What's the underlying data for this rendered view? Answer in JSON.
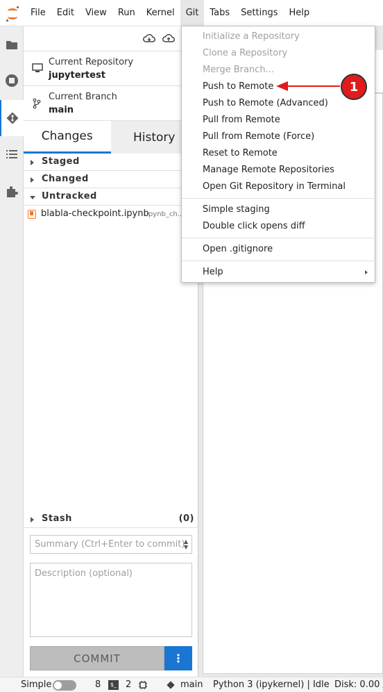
{
  "menubar": {
    "items": [
      "File",
      "Edit",
      "View",
      "Run",
      "Kernel",
      "Git",
      "Tabs",
      "Settings",
      "Help"
    ],
    "active": "Git"
  },
  "git_panel": {
    "repo_label": "Current Repository",
    "repo_value": "jupytertest",
    "branch_label": "Current Branch",
    "branch_value": "main",
    "tabs": {
      "changes": "Changes",
      "history": "History"
    },
    "sections": {
      "staged": "Staged",
      "changed": "Changed",
      "untracked": "Untracked",
      "stash": "Stash",
      "stash_count": "(0)"
    },
    "untracked_files": [
      {
        "name": "blabla-checkpoint.ipynb",
        "path": ".ipynb_ch..."
      }
    ],
    "summary_placeholder": "Summary (Ctrl+Enter to commit)",
    "description_placeholder": "Description (optional)",
    "commit_label": "COMMIT",
    "commit_more": "⋮"
  },
  "git_menu": {
    "items": [
      {
        "label": "Initialize a Repository",
        "disabled": true
      },
      {
        "label": "Clone a Repository",
        "disabled": true
      },
      {
        "label": "Merge Branch...",
        "disabled": true
      },
      {
        "label": "Push to Remote",
        "disabled": false
      },
      {
        "label": "Push to Remote (Advanced)",
        "disabled": false
      },
      {
        "label": "Pull from Remote",
        "disabled": false
      },
      {
        "label": "Pull from Remote (Force)",
        "disabled": false
      },
      {
        "label": "Reset to Remote",
        "disabled": false
      },
      {
        "label": "Manage Remote Repositories",
        "disabled": false
      },
      {
        "label": "Open Git Repository in Terminal",
        "disabled": false
      },
      {
        "label": "Simple staging",
        "disabled": false
      },
      {
        "label": "Double click opens diff",
        "disabled": false
      },
      {
        "label": "Open .gitignore",
        "disabled": false
      },
      {
        "label": "Help",
        "disabled": false,
        "submenu": true
      }
    ]
  },
  "annotation": {
    "badge": "1",
    "color": "#e01b1b"
  },
  "statusbar": {
    "mode": "Simple",
    "count1": "8",
    "terminal_icon": "$_",
    "count2": "2",
    "branch": "main",
    "kernel": "Python 3 (ipykernel) | Idle",
    "disk": "Disk: 0.00 /"
  },
  "colors": {
    "accent": "#1976d2",
    "brand": "#f37726"
  }
}
